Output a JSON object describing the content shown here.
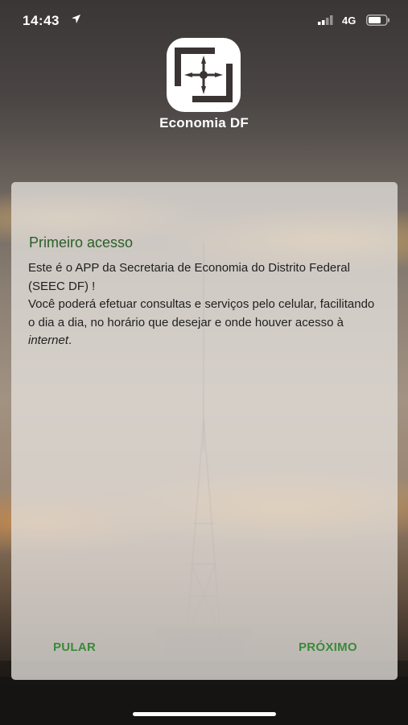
{
  "status_bar": {
    "time": "14:43",
    "network": "4G",
    "icons": [
      "location-arrow-icon",
      "signal-icon",
      "battery-icon"
    ]
  },
  "logo": {
    "text": "Economia DF",
    "icon": "economia-df-logo-icon"
  },
  "card": {
    "title": "Primeiro acesso",
    "line1": "Este é o APP da Secretaria de Economia do Distrito Federal (SEEC DF) !",
    "line2_prefix": "Você poderá efetuar consultas e serviços pelo celular, facilitando o dia a dia, no horário que desejar e onde houver acesso à ",
    "line2_italic": "internet",
    "line2_suffix": "."
  },
  "buttons": {
    "skip_label": "PULAR",
    "next_label": "PRÓXIMO"
  },
  "colors": {
    "title_green": "#2c5e27",
    "button_green": "#3a8a3a",
    "card_background": "rgba(228,224,220,0.78)"
  }
}
